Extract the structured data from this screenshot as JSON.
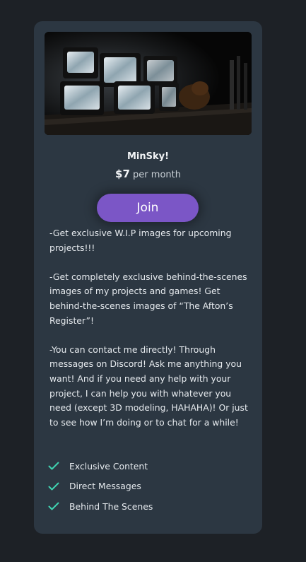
{
  "tier": {
    "name": "MinSky!",
    "price": "$7",
    "period": "per month"
  },
  "join_label": "Join",
  "description": [
    "-Get exclusive W.I.P images for upcoming projects!!!",
    "-Get completely exclusive behind-the-scenes images of my projects and games! Get behind-the-scenes images of “The Afton’s Register”!",
    "-You can contact me directly! Through messages on Discord! Ask me anything you want! And if you need any help with your project, I can help you with whatever you need (except 3D modeling, HAHAHA)! Or just to see how I’m doing or to chat for a while!"
  ],
  "benefits": [
    {
      "label": "Exclusive Content",
      "icon": "check-icon"
    },
    {
      "label": "Direct Messages",
      "icon": "check-icon"
    },
    {
      "label": "Behind The Scenes",
      "icon": "check-icon"
    }
  ],
  "colors": {
    "page_bg": "#1d2126",
    "card_bg": "#2c3742",
    "accent": "#7b56c6",
    "check": "#3fd3b1"
  }
}
